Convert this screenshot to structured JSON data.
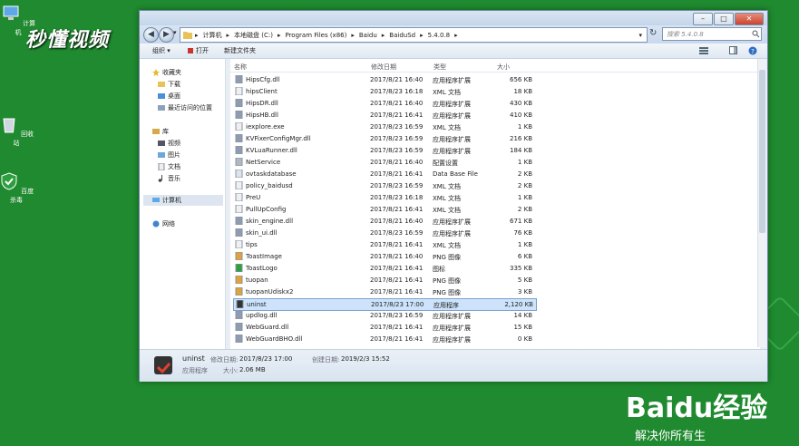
{
  "desktop": {
    "icons": [
      {
        "label": "计算机"
      },
      {
        "label": "回收站"
      },
      {
        "label": "百度杀毒"
      }
    ],
    "watermark_top": "秒懂视频",
    "baidu_logo": "Baidu经验",
    "baidu_sub": "解决你所有生"
  },
  "window": {
    "controls": {
      "minimize": "–",
      "maximize": "□",
      "close": "✕"
    },
    "nav": {
      "back": "◀",
      "forward": "▶",
      "dropdown": "▾"
    },
    "address": {
      "segments": [
        "计算机",
        "本地磁盘 (C:)",
        "Program Files (x86)",
        "Baidu",
        "BaiduSd",
        "5.4.0.8"
      ],
      "separator": "▸",
      "dropdown": "▾"
    },
    "refresh": "↻",
    "search": {
      "placeholder": "搜索 5.4.0.8"
    },
    "toolbar": {
      "organize": "组织 ▾",
      "open": "打开",
      "new_folder": "新建文件夹"
    },
    "sidebar": {
      "favorites": "收藏夹",
      "downloads": "下载",
      "desktop": "桌面",
      "recent": "最近访问的位置",
      "libraries": "库",
      "videos": "视频",
      "pictures": "图片",
      "documents": "文档",
      "music": "音乐",
      "computer": "计算机",
      "network": "网络"
    },
    "columns": {
      "name": "名称",
      "date": "修改日期",
      "type": "类型",
      "size": "大小"
    },
    "files": [
      {
        "name": "HipsCfg.dll",
        "date": "2017/8/21 16:40",
        "type": "应用程序扩展",
        "size": "656 KB",
        "icon": "dll"
      },
      {
        "name": "hipsClient",
        "date": "2017/8/23 16:18",
        "type": "XML 文档",
        "size": "18 KB",
        "icon": "xml"
      },
      {
        "name": "HipsDR.dll",
        "date": "2017/8/21 16:40",
        "type": "应用程序扩展",
        "size": "430 KB",
        "icon": "dll"
      },
      {
        "name": "HipsHB.dll",
        "date": "2017/8/21 16:41",
        "type": "应用程序扩展",
        "size": "410 KB",
        "icon": "dll"
      },
      {
        "name": "iexplore.exe",
        "date": "2017/8/23 16:59",
        "type": "XML 文档",
        "size": "1 KB",
        "icon": "xml"
      },
      {
        "name": "KVFixerConfigMgr.dll",
        "date": "2017/8/23 16:59",
        "type": "应用程序扩展",
        "size": "216 KB",
        "icon": "dll"
      },
      {
        "name": "KVLuaRunner.dll",
        "date": "2017/8/23 16:59",
        "type": "应用程序扩展",
        "size": "184 KB",
        "icon": "dll"
      },
      {
        "name": "NetService",
        "date": "2017/8/21 16:40",
        "type": "配置设置",
        "size": "1 KB",
        "icon": "cfg"
      },
      {
        "name": "ovtaskdatabase",
        "date": "2017/8/21 16:41",
        "type": "Data Base File",
        "size": "2 KB",
        "icon": "db"
      },
      {
        "name": "policy_baidusd",
        "date": "2017/8/23 16:59",
        "type": "XML 文档",
        "size": "2 KB",
        "icon": "xml"
      },
      {
        "name": "PreU",
        "date": "2017/8/23 16:18",
        "type": "XML 文档",
        "size": "1 KB",
        "icon": "xml"
      },
      {
        "name": "PullUpConfig",
        "date": "2017/8/21 16:41",
        "type": "XML 文档",
        "size": "2 KB",
        "icon": "xml"
      },
      {
        "name": "skin_engine.dll",
        "date": "2017/8/21 16:40",
        "type": "应用程序扩展",
        "size": "671 KB",
        "icon": "dll"
      },
      {
        "name": "skin_ui.dll",
        "date": "2017/8/23 16:59",
        "type": "应用程序扩展",
        "size": "76 KB",
        "icon": "dll"
      },
      {
        "name": "tips",
        "date": "2017/8/21 16:41",
        "type": "XML 文档",
        "size": "1 KB",
        "icon": "xml"
      },
      {
        "name": "ToastImage",
        "date": "2017/8/21 16:40",
        "type": "PNG 图像",
        "size": "6 KB",
        "icon": "png"
      },
      {
        "name": "ToastLogo",
        "date": "2017/8/21 16:41",
        "type": "图标",
        "size": "335 KB",
        "icon": "shield"
      },
      {
        "name": "tuopan",
        "date": "2017/8/21 16:41",
        "type": "PNG 图像",
        "size": "5 KB",
        "icon": "png"
      },
      {
        "name": "tuopanUdiskx2",
        "date": "2017/8/21 16:41",
        "type": "PNG 图像",
        "size": "3 KB",
        "icon": "png"
      },
      {
        "name": "uninst",
        "date": "2017/8/23 17:00",
        "type": "应用程序",
        "size": "2,120 KB",
        "icon": "exe",
        "selected": true
      },
      {
        "name": "updlog.dll",
        "date": "2017/8/23 16:59",
        "type": "应用程序扩展",
        "size": "14 KB",
        "icon": "dll"
      },
      {
        "name": "WebGuard.dll",
        "date": "2017/8/21 16:41",
        "type": "应用程序扩展",
        "size": "15 KB",
        "icon": "dll"
      },
      {
        "name": "WebGuardBHO.dll",
        "date": "2017/8/21 16:41",
        "type": "应用程序扩展",
        "size": "0 KB",
        "icon": "dll"
      }
    ],
    "details": {
      "filename": "uninst",
      "modified_label": "修改日期:",
      "modified": "2017/8/23 17:00",
      "created_label": "创建日期:",
      "created": "2019/2/3 15:52",
      "type": "应用程序",
      "size_label": "大小:",
      "size": "2.06 MB"
    }
  }
}
